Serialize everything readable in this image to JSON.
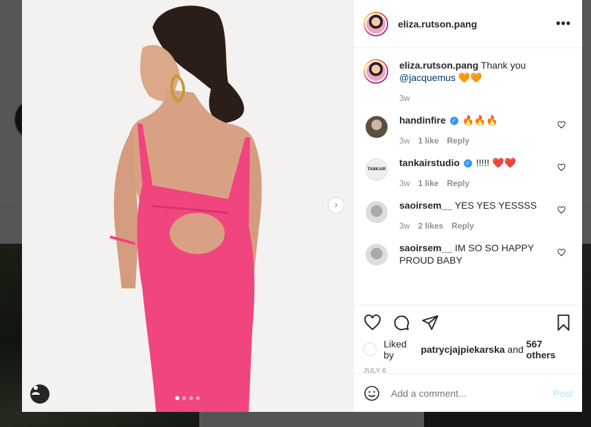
{
  "post": {
    "username": "eliza.rutson.pang",
    "more_icon": "more-horizontal-icon",
    "caption": {
      "username": "eliza.rutson.pang",
      "text": "Thank you",
      "mention": "@jacquemus",
      "emoji": "🧡🧡",
      "time": "3w"
    },
    "carousel": {
      "dots": 4,
      "active": 0
    },
    "likes_by": "patrycjajpiekarska",
    "likes_others": "567 others",
    "likes_prefix": "Liked by",
    "likes_and": "and",
    "date": "JULY 6",
    "add_comment_placeholder": "Add a comment...",
    "post_label": "Post"
  },
  "comments": [
    {
      "username": "handinfire",
      "verified": true,
      "text": "🔥🔥🔥",
      "time": "3w",
      "likes": "1 like",
      "reply": "Reply"
    },
    {
      "username": "tankairstudio",
      "verified": true,
      "text": "!!!!! ❤️❤️",
      "time": "3w",
      "likes": "1 like",
      "reply": "Reply",
      "avatar_text": "TANKAIR"
    },
    {
      "username": "saoirsem__",
      "verified": false,
      "text": "YES YES YESSSS",
      "time": "3w",
      "likes": "2 likes",
      "reply": "Reply"
    },
    {
      "username": "saoirsem__",
      "verified": false,
      "text": "IM SO SO HAPPY PROUD BABY",
      "time": "",
      "likes": "",
      "reply": ""
    }
  ],
  "colors": {
    "accent": "#3897f0",
    "dress": "#f0457f",
    "post_disabled": "#b2dffc"
  }
}
